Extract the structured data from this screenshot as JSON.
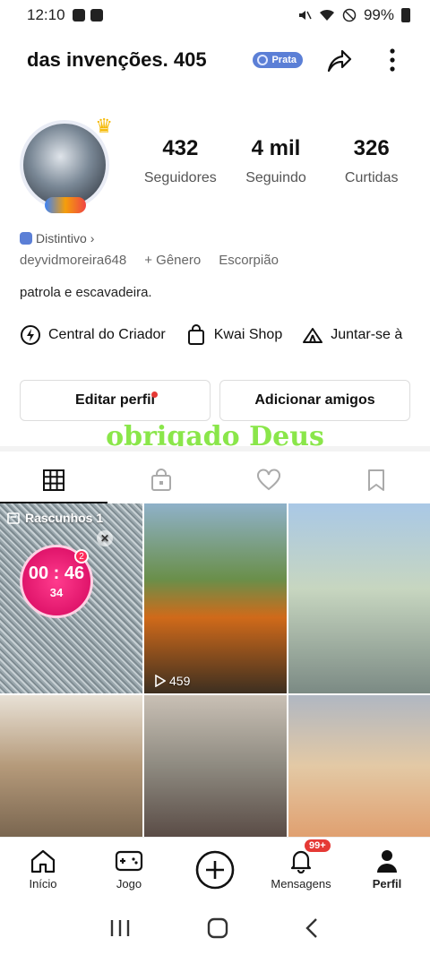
{
  "status_bar": {
    "time": "12:10",
    "battery": "99%"
  },
  "header": {
    "username": "das invenções. 405",
    "badge": "Prata"
  },
  "profile": {
    "stats": [
      {
        "value": "432",
        "label": "Seguidores"
      },
      {
        "value": "4 mil",
        "label": "Seguindo"
      },
      {
        "value": "326",
        "label": "Curtidas"
      }
    ],
    "distintivo": "Distintivo",
    "handle": "deyvidmoreira648",
    "gender": "+ Gênero",
    "sign": "Escorpião",
    "bio": "patrola e escavadeira."
  },
  "quick_links": [
    {
      "label": "Central do Criador"
    },
    {
      "label": "Kwai Shop"
    },
    {
      "label": "Juntar-se à"
    }
  ],
  "actions": {
    "edit": "Editar perfil",
    "add_friends": "Adicionar amigos"
  },
  "overlay_text": "obrigado Deus",
  "grid": {
    "drafts_label": "Rascunhos 1",
    "timer": "00 : 46",
    "timer_badge": "2",
    "coins": "34",
    "plays_1": "459"
  },
  "bottom_nav": [
    {
      "label": "Início"
    },
    {
      "label": "Jogo"
    },
    {
      "label": ""
    },
    {
      "label": "Mensagens",
      "badge": "99+"
    },
    {
      "label": "Perfil"
    }
  ],
  "colors": {
    "accent_green": "#8ae64a",
    "badge_blue": "#5b7fd6",
    "notification_red": "#e53935"
  }
}
